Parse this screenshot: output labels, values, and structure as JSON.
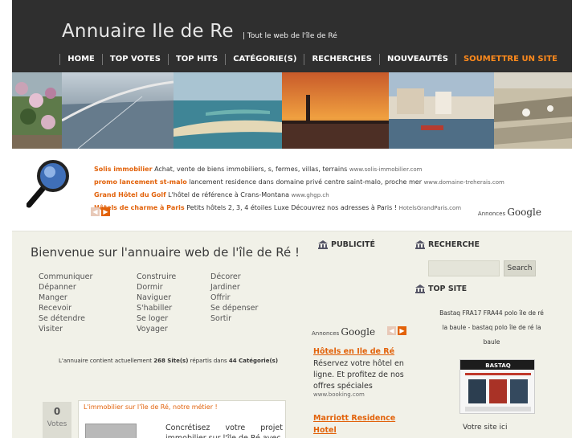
{
  "header": {
    "title": "Annuaire Ile de Re",
    "tagline": "| Tout le web de l'île de Ré",
    "nav": [
      "HOME",
      "TOP VOTES",
      "TOP HITS",
      "CATÉGORIE(S)",
      "RECHERCHES",
      "NOUVEAUTÉS",
      "SOUMETTRE UN SITE"
    ],
    "accent_color": "#ff8a1c"
  },
  "ads_top": {
    "items": [
      {
        "title": "Solis immobilier",
        "desc": "Achat, vente de biens immobiliers, s, fermes, villas, terrains",
        "url": "www.solis-immobilier.com"
      },
      {
        "title": "promo lancement st-malo",
        "desc": "lancement residence dans domaine privé centre saint-malo, proche mer",
        "url": "www.domaine-treherais.com"
      },
      {
        "title": "Grand Hôtel du Golf",
        "desc": "L'hôtel de référence à Crans-Montana",
        "url": "www.ghgp.ch"
      },
      {
        "title": "Hôtels de charme à Paris",
        "desc": "Petits hôtels 2, 3, 4 étoiles Luxe Découvrez nos adresses à Paris !",
        "url": "HotelsGrandParis.com"
      }
    ],
    "brand_prefix": "Annonces",
    "brand_name": "Google",
    "prev_icon": "arrow-left-icon",
    "next_icon": "arrow-right-icon"
  },
  "main": {
    "welcome": "Bienvenue sur l'annuaire web de l'île de Ré !",
    "categories_col1": [
      "Communiquer",
      "Dépanner",
      "Manger",
      "Recevoir",
      "Se détendre",
      "Visiter"
    ],
    "categories_col2": [
      "Construire",
      "Dormir",
      "Naviguer",
      "S'habiller",
      "Se loger",
      "Voyager"
    ],
    "categories_col3": [
      "Décorer",
      "Jardiner",
      "Offrir",
      "Se dépenser",
      "Sortir"
    ],
    "stats_prefix": "L'annuaire contient actuellement",
    "stats_sites": "268 Site(s)",
    "stats_middle": "répartis dans",
    "stats_cats": "44 Catégorie(s)",
    "vote_count": "0",
    "vote_label": "Votes",
    "featured_title": "L'immobilier sur l'île de Ré, notre métier !",
    "featured_text": "Concrétisez votre projet immobilier sur l'île de Ré avec"
  },
  "publicite": {
    "title": "PUBLICITÉ",
    "brand_prefix": "Annonces",
    "brand_name": "Google",
    "ad1_title": "Hôtels en Ile de Ré",
    "ad1_desc": "Réservez votre hôtel en ligne. Et profitez de nos offres spéciales",
    "ad1_url": "www.booking.com",
    "ad2_title_line1": "Marriott Residence",
    "ad2_title_line2": "Hotel"
  },
  "recherche": {
    "title": "RECHERCHE",
    "input_value": "",
    "button_label": "Search"
  },
  "topsite": {
    "title": "TOP SITE",
    "desc": "Bastaq FRA17 FRA44 polo île de ré la baule - bastaq polo île de ré la baule",
    "thumb_brand": "BASTAQ",
    "caption": "Votre site ici"
  }
}
